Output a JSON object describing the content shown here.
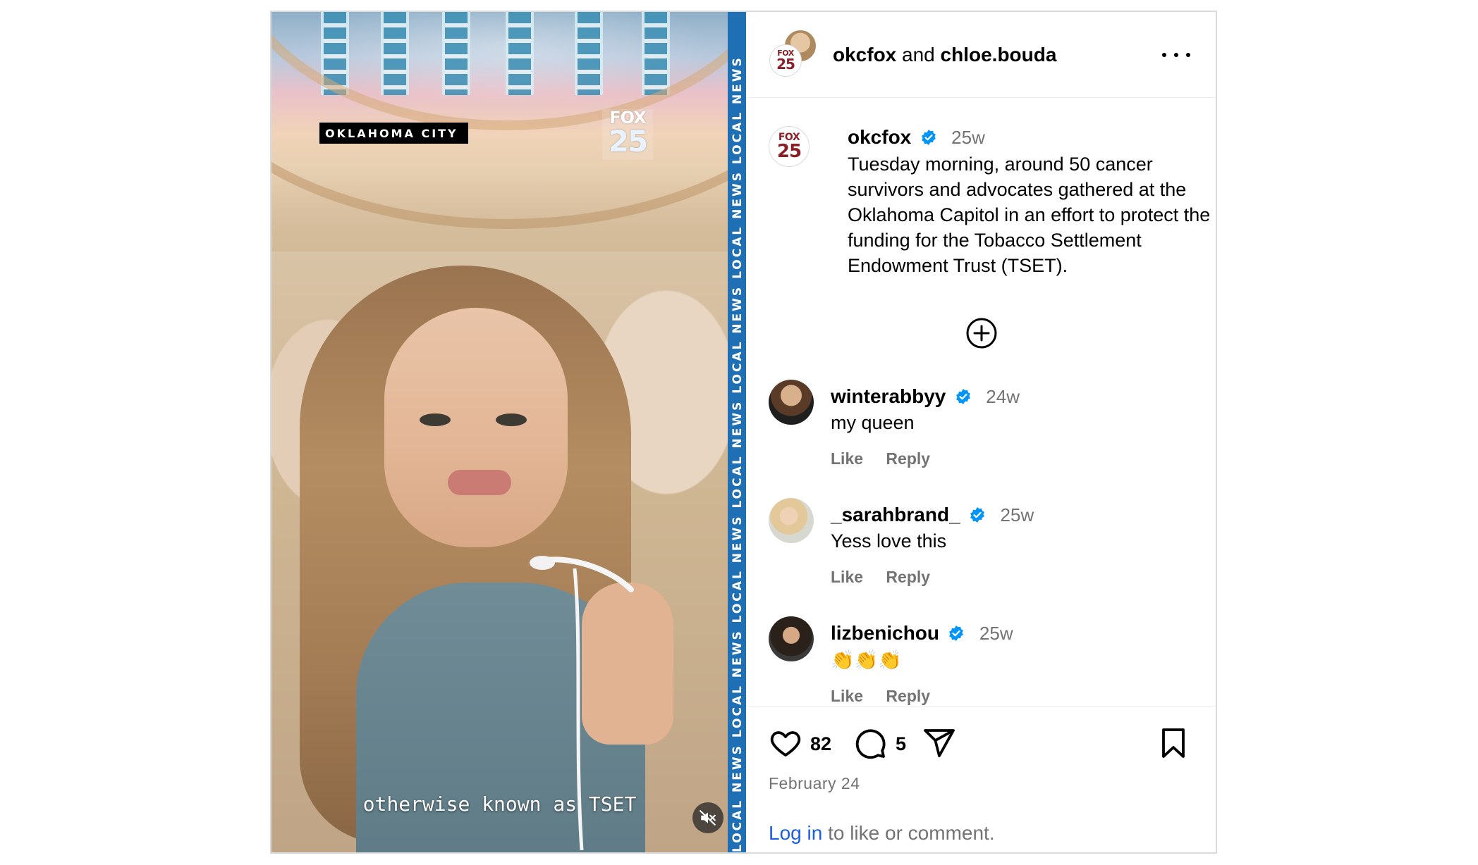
{
  "media": {
    "location_tag": "OKLAHOMA CITY",
    "logo_top": "FOX",
    "logo_number": "25",
    "side_band_text": "LOCAL NEWS   LOCAL NEWS   LOCAL NEWS   LOCAL NEWS   LOCAL NEWS   LOCAL NEWS   LOCAL NEWS",
    "subtitle": "otherwise known as TSET",
    "mute_icon": "speaker-muted-icon"
  },
  "header": {
    "account_1": "okcfox",
    "connector": "and",
    "account_2": "chloe.bouda",
    "more_icon": "more-horizontal-icon"
  },
  "post_caption": {
    "username": "okcfox",
    "time_ago": "25w",
    "text": "Tuesday morning, around 50 cancer survivors and advocates gathered at the Oklahoma Capitol in an effort to protect the funding for the Tobacco Settlement Endowment Trust (TSET).",
    "avatar_top": "FOX",
    "avatar_number": "25"
  },
  "load_more_icon": "plus-circle-icon",
  "comments": [
    {
      "username": "winterabbyy",
      "time_ago": "24w",
      "text": "my queen",
      "like": "Like",
      "reply": "Reply"
    },
    {
      "username": "_sarahbrand_",
      "time_ago": "25w",
      "text": "Yess love this",
      "like": "Like",
      "reply": "Reply"
    },
    {
      "username": "lizbenichou",
      "time_ago": "25w",
      "text": "👏👏👏",
      "like": "Like",
      "reply": "Reply"
    }
  ],
  "actions": {
    "like_icon": "heart-icon",
    "like_count": "82",
    "comment_icon": "comment-icon",
    "comment_count": "5",
    "share_icon": "share-icon",
    "save_icon": "bookmark-icon",
    "date": "February 24",
    "login_link": "Log in",
    "login_rest": " to like or comment."
  },
  "colors": {
    "verified": "#0095f6",
    "link": "#1b5fe0",
    "secondary_text": "#737373",
    "band": "#1e6fb3"
  }
}
